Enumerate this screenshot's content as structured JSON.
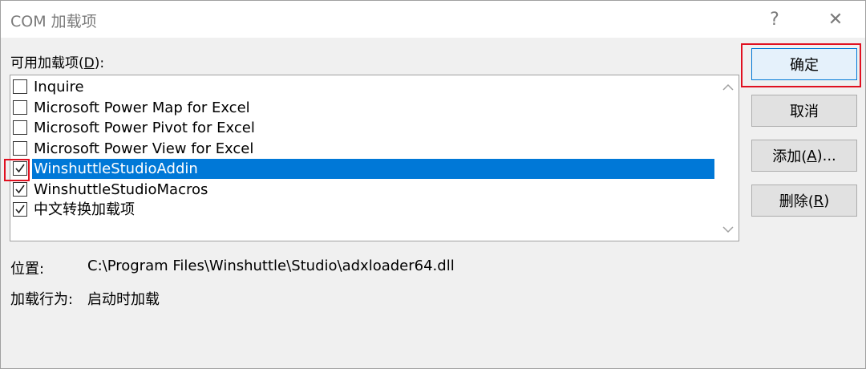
{
  "dialog": {
    "title": "COM 加载项",
    "help_icon": "?",
    "close_icon": "✕"
  },
  "list": {
    "label_prefix": "可用加载项(",
    "label_accel": "D",
    "label_suffix": "):",
    "items": [
      {
        "label": "Inquire",
        "checked": false,
        "selected": false
      },
      {
        "label": "Microsoft Power Map for Excel",
        "checked": false,
        "selected": false
      },
      {
        "label": "Microsoft Power Pivot for Excel",
        "checked": false,
        "selected": false
      },
      {
        "label": "Microsoft Power View for Excel",
        "checked": false,
        "selected": false
      },
      {
        "label": "WinshuttleStudioAddin",
        "checked": true,
        "selected": true
      },
      {
        "label": "WinshuttleStudioMacros",
        "checked": true,
        "selected": false
      },
      {
        "label": "中文转换加载项",
        "checked": true,
        "selected": false
      }
    ]
  },
  "buttons": {
    "ok": "确定",
    "cancel": "取消",
    "add_prefix": "添加(",
    "add_accel": "A",
    "add_suffix": ")...",
    "remove_prefix": "删除(",
    "remove_accel": "R",
    "remove_suffix": ")"
  },
  "details": {
    "location_label": "位置:",
    "location_value": "C:\\Program Files\\Winshuttle\\Studio\\adxloader64.dll",
    "behavior_label": "加载行为:",
    "behavior_value": "启动时加载"
  },
  "colors": {
    "selection": "#0078d7",
    "annotation_red": "#e01020"
  }
}
